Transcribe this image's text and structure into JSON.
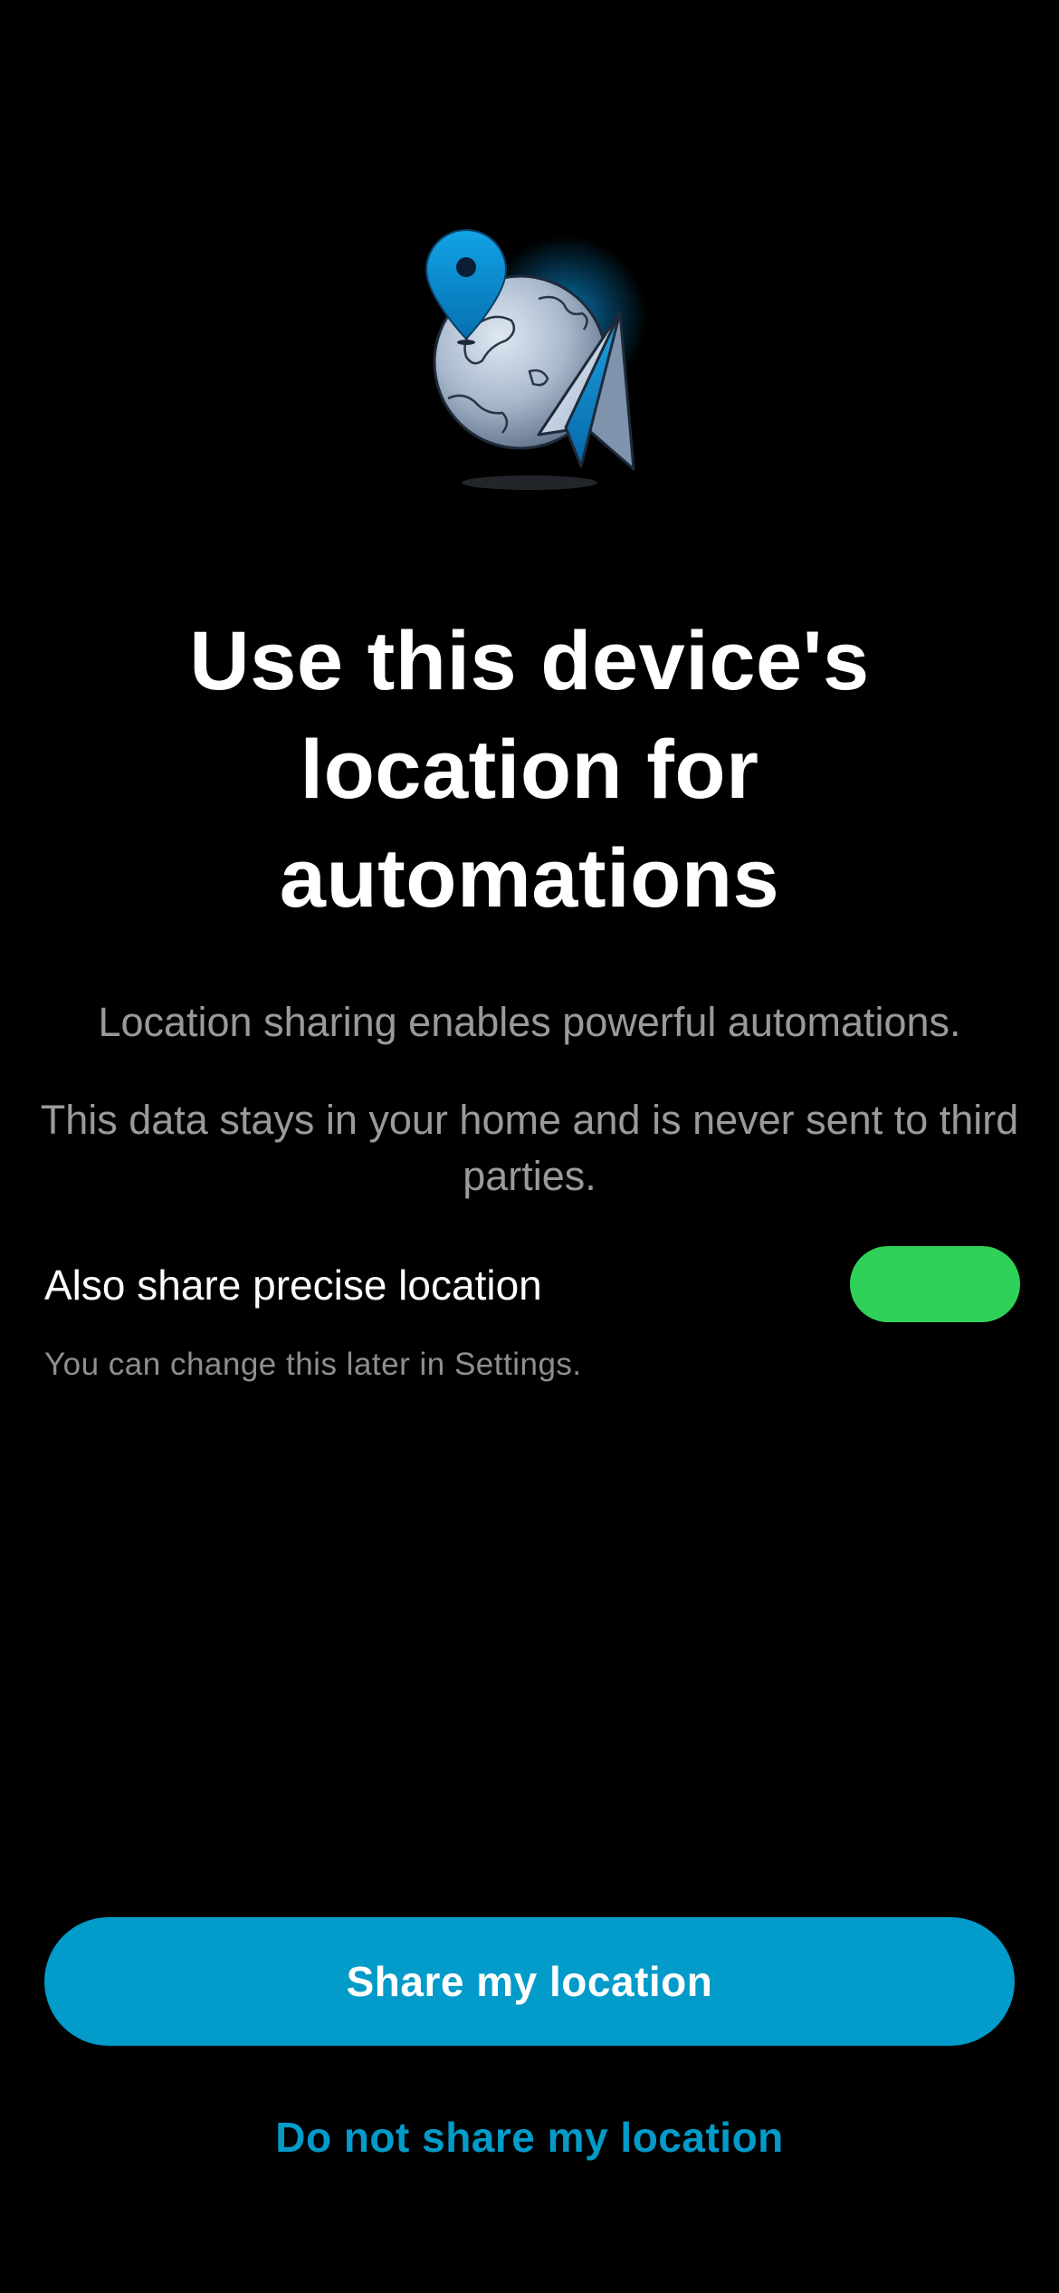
{
  "hero": {
    "icon": "globe-location-paper-plane-icon"
  },
  "title": "Use this device's location for automations",
  "description": {
    "line1": "Location sharing enables powerful automations.",
    "line2": "This data stays in your home and is never sent to third parties."
  },
  "precise_location": {
    "label": "Also share precise location",
    "enabled": true,
    "hint": "You can change this later in Settings."
  },
  "actions": {
    "share_label": "Share my location",
    "decline_label": "Do not share my location"
  },
  "colors": {
    "background": "#000000",
    "accent": "#039bc9",
    "toggle_on": "#30d158",
    "secondary_text": "#9a9a9e"
  }
}
